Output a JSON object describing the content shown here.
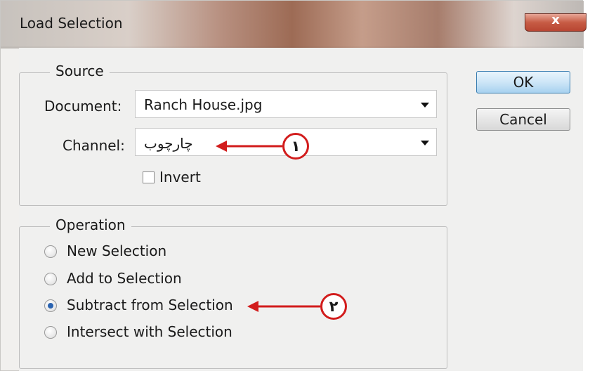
{
  "window": {
    "title": "Load Selection",
    "close_glyph": "x"
  },
  "buttons": {
    "ok_label": "OK",
    "cancel_label": "Cancel"
  },
  "source_group": {
    "legend": "Source",
    "document_label": "Document:",
    "document_value": "Ranch House.jpg",
    "channel_label": "Channel:",
    "channel_value": "چارچوب",
    "invert_label": "Invert",
    "invert_checked": false
  },
  "operation_group": {
    "legend": "Operation",
    "options": [
      {
        "label": "New Selection",
        "selected": false
      },
      {
        "label": "Add to Selection",
        "selected": false
      },
      {
        "label": "Subtract from Selection",
        "selected": true
      },
      {
        "label": "Intersect with Selection",
        "selected": false
      }
    ]
  },
  "annotations": {
    "marker_1": "١",
    "marker_2": "٢",
    "color": "#d21c1c"
  },
  "colors": {
    "dialog_bg": "#f0f0ef",
    "default_button": "#a7d1ef",
    "close_button": "#c75c45"
  }
}
